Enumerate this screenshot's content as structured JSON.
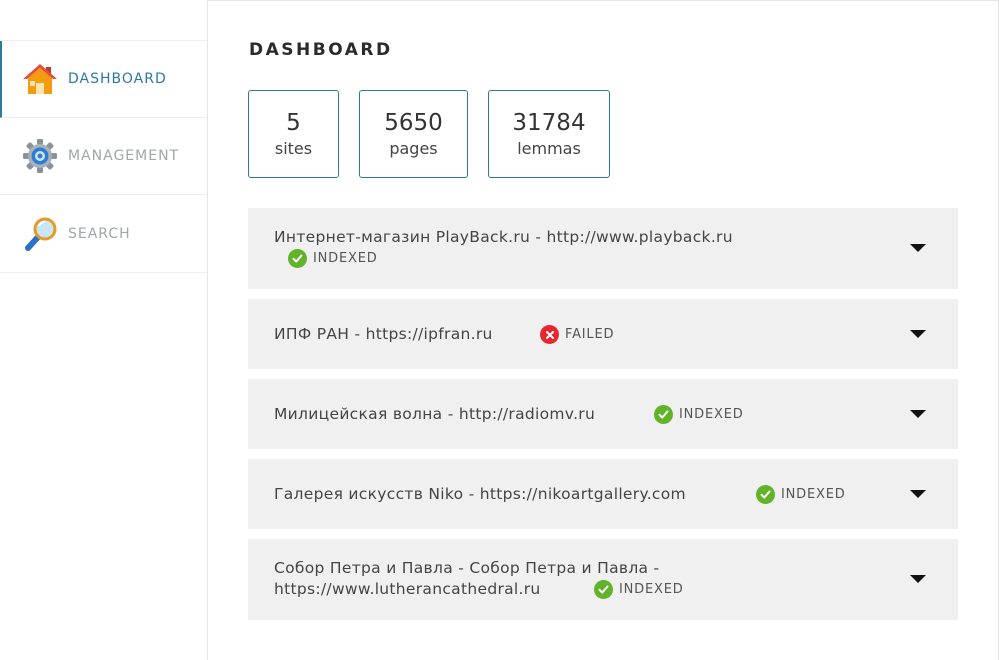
{
  "sidebar": {
    "items": [
      {
        "label": "DASHBOARD",
        "icon": "house-icon"
      },
      {
        "label": "MANAGEMENT",
        "icon": "gear-icon"
      },
      {
        "label": "SEARCH",
        "icon": "magnifier-icon"
      }
    ]
  },
  "main": {
    "title": "DASHBOARD",
    "stats": [
      {
        "value": "5",
        "label": "sites"
      },
      {
        "value": "5650",
        "label": "pages"
      },
      {
        "value": "31784",
        "label": "lemmas"
      }
    ],
    "sites": [
      {
        "line1": "Интернет-магазин PlayBack.ru - http://www.playback.ru",
        "line2": "",
        "status": "INDEXED"
      },
      {
        "line1": "ИПФ РАН - https://ipfran.ru",
        "line2": "",
        "status": "FAILED"
      },
      {
        "line1": "Милицейская волна - http://radiomv.ru",
        "line2": "",
        "status": "INDEXED"
      },
      {
        "line1": "Галерея искусств Niko - https://nikoartgallery.com",
        "line2": "",
        "status": "INDEXED"
      },
      {
        "line1": "Собор Петра и Павла - Собор Петра и Павла -",
        "line2": "https://www.lutherancathedral.ru",
        "status": "INDEXED"
      }
    ]
  },
  "colors": {
    "accent": "#2e7a9d",
    "indexed": "#61b32a",
    "failed": "#e5282f",
    "card_bg": "#f0f0f0"
  }
}
